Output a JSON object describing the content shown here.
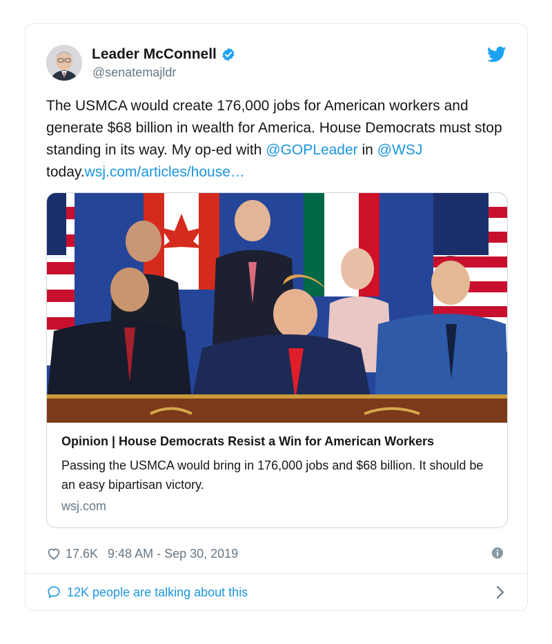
{
  "author": {
    "display_name": "Leader McConnell",
    "handle": "@senatemajldr",
    "verified": true
  },
  "tweet": {
    "text_segments": {
      "main": "The USMCA would create 176,000 jobs for American workers and generate $68 billion in wealth for America. House Democrats must stop standing in its way. My op-ed with ",
      "mention1": "@GOPLeader",
      "in": " in ",
      "mention2": "@WSJ",
      "today": " today.",
      "url": "wsj.com/articles/house…"
    }
  },
  "link_card": {
    "title": "Opinion | House Democrats Resist a Win for American Workers",
    "description": "Passing the USMCA would bring in 176,000 jobs and $68 billion. It should be an easy bipartisan victory.",
    "domain": "wsj.com",
    "image_alt": "Leaders signing the USMCA agreement at a table in front of flags"
  },
  "meta": {
    "likes": "17.6K",
    "timestamp": "9:48 AM - Sep 30, 2019"
  },
  "conversation": {
    "label": "12K people are talking about this"
  },
  "icons": {
    "verified": "verified-badge-icon",
    "bird": "twitter-bird-icon",
    "heart": "heart-icon",
    "info": "info-icon",
    "bubble": "speech-bubble-icon",
    "chevron": "chevron-right-icon"
  },
  "colors": {
    "link": "#1b95e0",
    "secondary_text": "#657786",
    "border": "#e1e8ed",
    "verified": "#1da1f2"
  }
}
